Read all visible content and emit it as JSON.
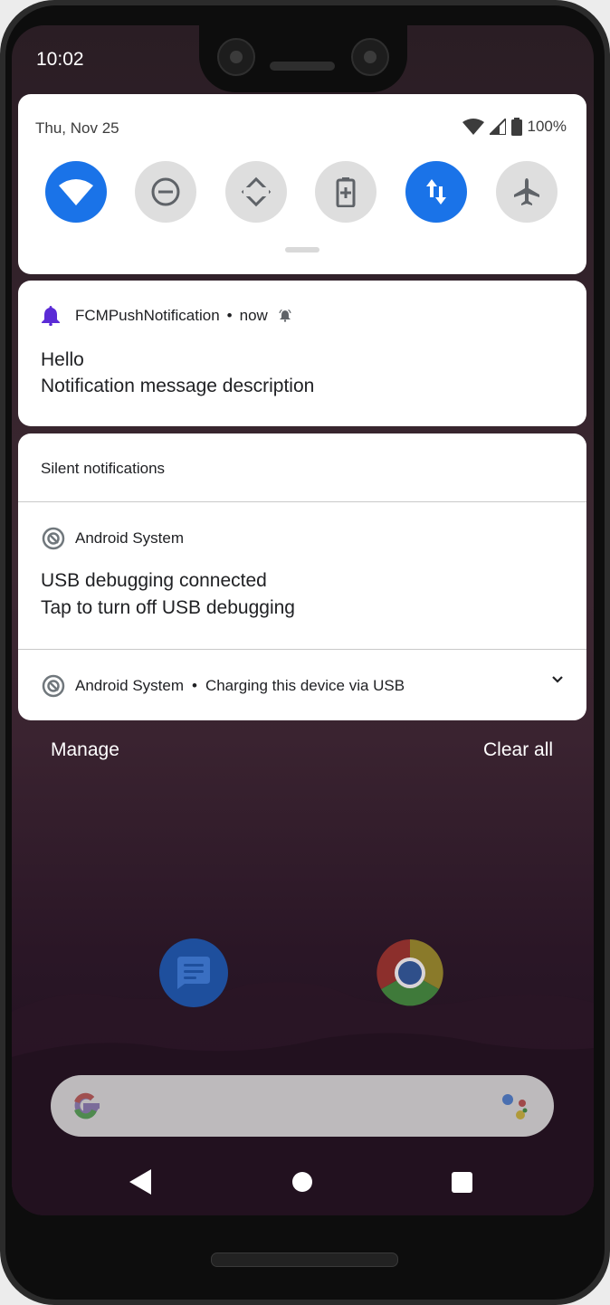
{
  "status_bar": {
    "time": "10:02"
  },
  "quick_settings": {
    "date": "Thu, Nov 25",
    "battery": "100%",
    "tiles": [
      {
        "name": "wifi-icon",
        "active": true
      },
      {
        "name": "do-not-disturb-icon",
        "active": false
      },
      {
        "name": "auto-rotate-icon",
        "active": false
      },
      {
        "name": "battery-saver-icon",
        "active": false
      },
      {
        "name": "mobile-data-icon",
        "active": true
      },
      {
        "name": "airplane-mode-icon",
        "active": false
      }
    ]
  },
  "notifications": {
    "push": {
      "app": "FCMPushNotification",
      "separator": "•",
      "time": "now",
      "title": "Hello",
      "text": "Notification message description"
    },
    "silent_header": "Silent notifications",
    "usb_debug": {
      "app": "Android System",
      "title": "USB debugging connected",
      "text": "Tap to turn off USB debugging"
    },
    "charging": {
      "app": "Android System",
      "separator": "•",
      "text": "Charging this device via USB"
    }
  },
  "actions": {
    "manage": "Manage",
    "clear_all": "Clear all"
  },
  "colors": {
    "accent": "#1a73e8",
    "notif_icon": "#5b2bd6",
    "tile_inactive": "#dedede"
  }
}
